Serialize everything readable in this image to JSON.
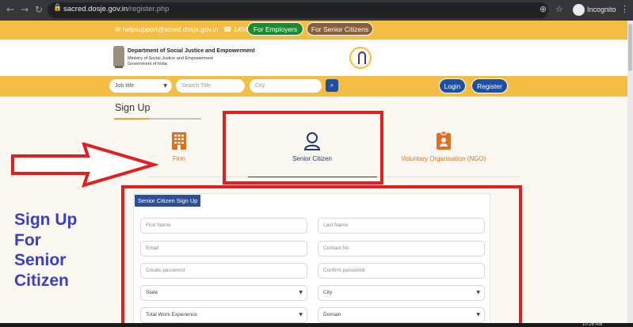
{
  "browser": {
    "url_host": "sacred.dosje.gov.in",
    "url_path": "/register.php",
    "incognito_label": "Incognito"
  },
  "topbar": {
    "email": "helpsupport@scred.dosje.gov.in",
    "phone": "14567",
    "for_employers": "For Employers",
    "for_senior_citizens": "For Senior Citizens"
  },
  "header": {
    "dept_name": "Department of Social Justice and Empowerment",
    "ministry": "Ministry of Social Justice and Empowerment",
    "government": "Government of India"
  },
  "search": {
    "job_title": "Job title",
    "search_title_placeholder": "Search Title",
    "city_placeholder": "City",
    "login": "Login",
    "register": "Register"
  },
  "page": {
    "title": "Sign Up",
    "tabs": [
      {
        "label": "Firm"
      },
      {
        "label": "Senior Citizen"
      },
      {
        "label": "Voluntary Organisation (NGO)"
      }
    ],
    "active_tab": "Senior Citizen"
  },
  "form": {
    "heading": "Senior Citizen Sign Up",
    "fields": {
      "first_name": "First Name",
      "last_name": "Last Name",
      "email": "Email",
      "contact_no": "Contact No.",
      "create_password": "Create password",
      "confirm_password": "Confirm password",
      "state": "State",
      "city": "City",
      "total_work_experience": "Total Work Experience",
      "domain": "Domain"
    }
  },
  "annotation": {
    "lines": [
      "Sign Up",
      "For",
      "Senior",
      "Citizen"
    ]
  },
  "taskbar": {
    "time": "10:26 AM"
  },
  "colors": {
    "accent_yellow": "#f4be45",
    "primary_blue": "#1e4fa0",
    "employers_green": "#1a8b2e",
    "senior_brown": "#8b5e3c",
    "annotation_red": "#e02020",
    "annotation_text": "#3b3dc4",
    "tab_orange": "#e07020"
  }
}
